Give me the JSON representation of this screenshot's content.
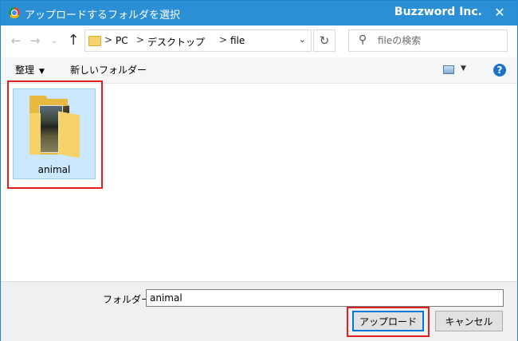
{
  "window": {
    "title": "アップロードするフォルダを選択",
    "brand": "Buzzword Inc.",
    "close_glyph": "✕"
  },
  "nav": {
    "back_glyph": "←",
    "forward_glyph": "→",
    "recent_glyph": "⌄",
    "up_glyph": "↑",
    "refresh_glyph": "↻"
  },
  "address": {
    "breadcrumbs": [
      "PC",
      "デスクトップ",
      "file"
    ],
    "separator": ">",
    "dropdown_glyph": "⌄"
  },
  "search": {
    "placeholder": "fileの検索",
    "icon_glyph": "⚲"
  },
  "toolbar": {
    "organize_label": "整理",
    "organize_caret": "▼",
    "new_folder_label": "新しいフォルダー",
    "view_caret": "▼",
    "help_glyph": "?"
  },
  "items": [
    {
      "name": "animal",
      "type": "folder",
      "selected": true
    }
  ],
  "footer": {
    "folder_label": "フォルダー:",
    "folder_value": "animal",
    "upload_label": "アップロード",
    "cancel_label": "キャンセル"
  },
  "colors": {
    "titlebar": "#2b8fd6",
    "selection_fill": "#cce8ff",
    "highlight_outline": "#e02020",
    "help_icon": "#1a73c8"
  }
}
